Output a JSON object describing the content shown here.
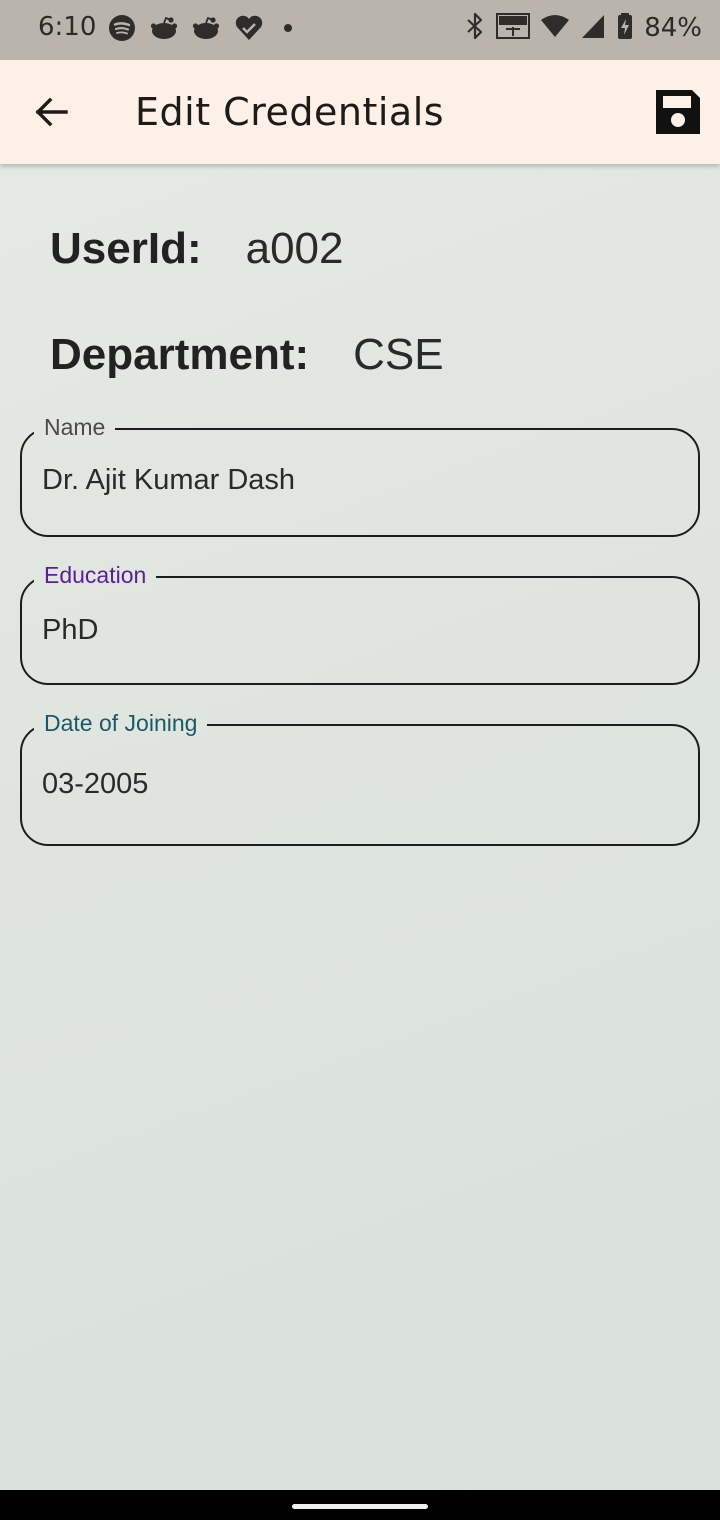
{
  "status_bar": {
    "time": "6:10",
    "battery_percent": "84%",
    "left_icons": [
      "spotify-icon",
      "reddit-icon",
      "reddit-icon",
      "heart-icon",
      "dot-icon"
    ],
    "right_icons": [
      "bluetooth-icon",
      "volte-icon",
      "wifi-icon",
      "signal-icon",
      "battery-charging-icon"
    ]
  },
  "app_bar": {
    "title": "Edit Credentials",
    "back_icon": "arrow-back-icon",
    "save_icon": "save-icon",
    "background": "#fdf0e6"
  },
  "info": {
    "user_id_label": "UserId:",
    "user_id_value": "a002",
    "department_label": "Department:",
    "department_value": "CSE"
  },
  "form": {
    "name": {
      "label": "Name",
      "value": "Dr. Ajit Kumar Dash"
    },
    "education": {
      "label": "Education",
      "value": "PhD",
      "label_color": "#5a1d9c"
    },
    "date_of_joining": {
      "label": "Date of Joining",
      "value": "03-2005",
      "label_color": "#1a5a66"
    }
  }
}
